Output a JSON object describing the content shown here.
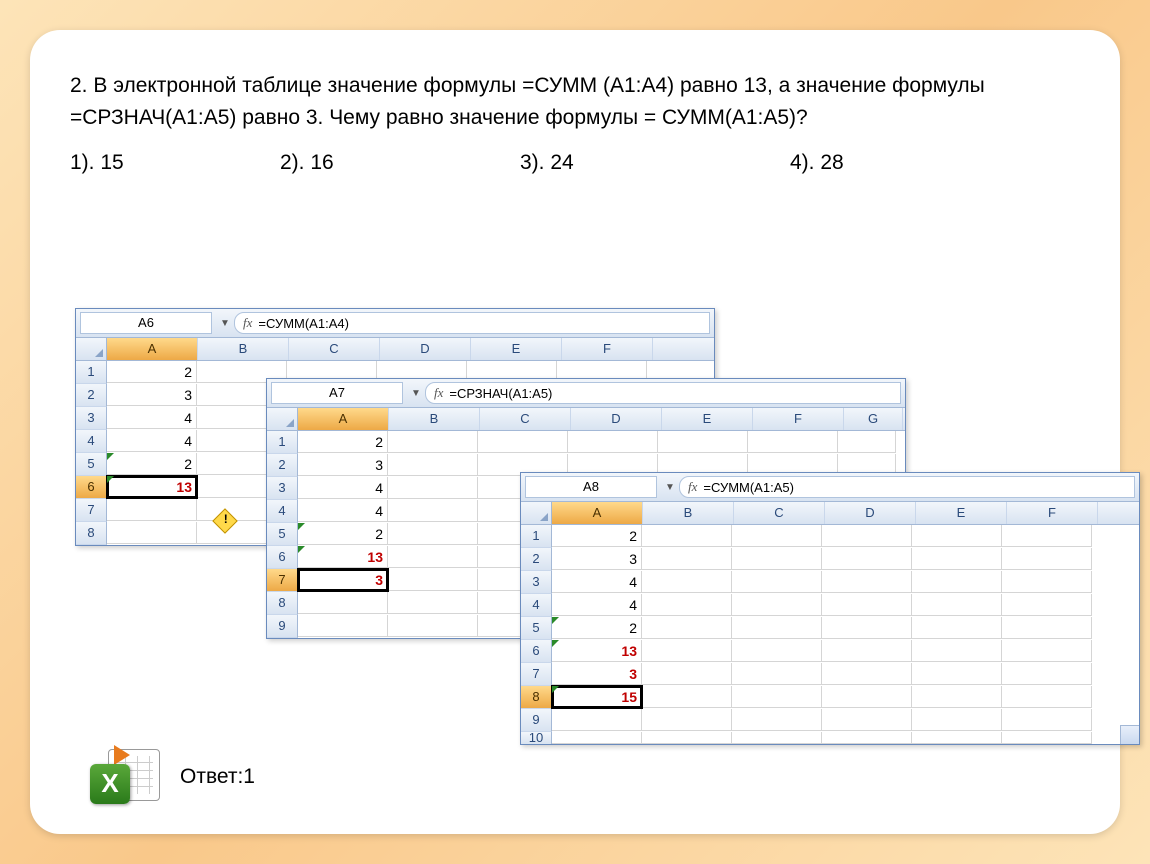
{
  "question": "2. В электронной таблице значение формулы  =СУММ (А1:А4) равно 13, а значение формулы =СРЗНАЧ(А1:А5) равно 3. Чему равно значение формулы = СУММ(А1:А5)?",
  "options": {
    "o1": "1). 15",
    "o2": "2). 16",
    "o3": "3). 24",
    "o4": "4). 28"
  },
  "shot1": {
    "cell_ref": "A6",
    "formula": "=СУММ(A1:A4)",
    "cols": [
      "A",
      "B",
      "C",
      "D",
      "E",
      "F"
    ],
    "rows": [
      "1",
      "2",
      "3",
      "4",
      "5",
      "6",
      "7",
      "8"
    ],
    "vals": {
      "r1": "2",
      "r2": "3",
      "r3": "4",
      "r4": "4",
      "r5": "2",
      "r6": "13"
    },
    "active_row": 6
  },
  "shot2": {
    "cell_ref": "A7",
    "formula": "=СРЗНАЧ(A1:A5)",
    "cols": [
      "A",
      "B",
      "C",
      "D",
      "E",
      "F",
      "G"
    ],
    "rows": [
      "1",
      "2",
      "3",
      "4",
      "5",
      "6",
      "7",
      "8",
      "9"
    ],
    "vals": {
      "r1": "2",
      "r2": "3",
      "r3": "4",
      "r4": "4",
      "r5": "2",
      "r6": "13",
      "r7": "3"
    },
    "active_row": 7
  },
  "shot3": {
    "cell_ref": "A8",
    "formula": "=СУММ(A1:A5)",
    "cols": [
      "A",
      "B",
      "C",
      "D",
      "E",
      "F"
    ],
    "rows": [
      "1",
      "2",
      "3",
      "4",
      "5",
      "6",
      "7",
      "8",
      "9",
      "10"
    ],
    "vals": {
      "r1": "2",
      "r2": "3",
      "r3": "4",
      "r4": "4",
      "r5": "2",
      "r6": "13",
      "r7": "3",
      "r8": "15"
    },
    "active_row": 8
  },
  "answer": "Ответ:1",
  "fx": "fx"
}
